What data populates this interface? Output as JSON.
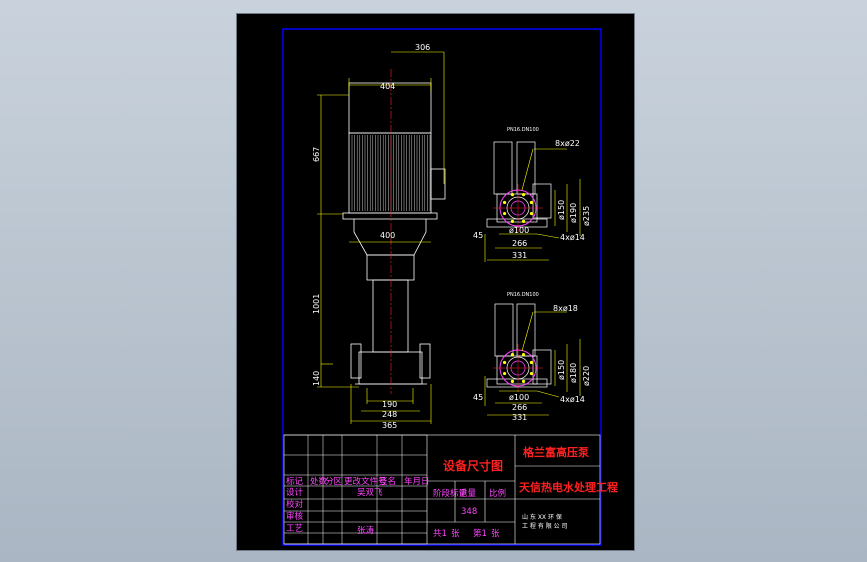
{
  "dims": {
    "top_width": "306",
    "motor_width": "404",
    "motor_height": "667",
    "base_width_top": "400",
    "pump_height": "1001",
    "bottom_offset": "140",
    "base1": "190",
    "base2": "248",
    "base3": "365"
  },
  "detail1": {
    "label": "PN16.DN100",
    "holes": "8xø22",
    "d1": "ø150",
    "d2": "ø190",
    "d3": "ø235",
    "bore": "ø100",
    "left": "45",
    "w1": "266",
    "w2": "331",
    "anchor": "4xø14"
  },
  "detail2": {
    "label": "PN16.DN100",
    "holes": "8xø18",
    "d1": "ø150",
    "d2": "ø180",
    "d3": "ø220",
    "bore": "ø100",
    "left": "45",
    "w1": "266",
    "w2": "331",
    "anchor": "4xø14"
  },
  "title_block": {
    "drawing_name": "设备尺寸图",
    "product": "格兰富高压泵",
    "project": "天信热电水处理工程",
    "row_labels": [
      "标记",
      "设计",
      "校对",
      "审核",
      "工艺"
    ],
    "header_cells": [
      "标记",
      "处数",
      "分区",
      "更改文件号",
      "签名",
      "年月日"
    ],
    "stage_label": "阶段标记",
    "weight_label": "重量",
    "scale_label": "比例",
    "weight_value": "348",
    "sheet_label": "共1",
    "sheet_label2": "张",
    "sheet_label3": "第1",
    "sheet_label4": "张",
    "company": "山 东 XX 环 保",
    "company2": "工 程 有 限 公 司"
  },
  "colors": {
    "line": "#ffffff",
    "dim": "#ffff00",
    "frame": "#0000ff",
    "center": "#ff2020",
    "title": "#ff2020",
    "tb_text": "#ff44ff",
    "flange": "#ff44ff"
  }
}
